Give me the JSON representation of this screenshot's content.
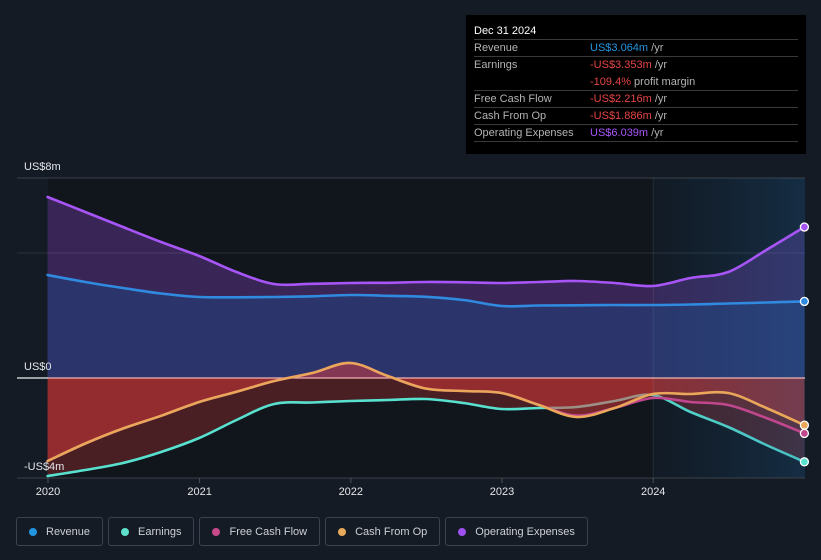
{
  "tooltip": {
    "date": "Dec 31 2024",
    "rows": [
      {
        "label": "Revenue",
        "value": "US$3.064m",
        "unit": "/yr",
        "color": "#2394df"
      },
      {
        "label": "Earnings",
        "value": "-US$3.353m",
        "unit": "/yr",
        "color": "#e64545"
      },
      {
        "label": "",
        "value": "-109.4%",
        "unit": "profit margin",
        "color": "#e64545"
      },
      {
        "label": "Free Cash Flow",
        "value": "-US$2.216m",
        "unit": "/yr",
        "color": "#e64545"
      },
      {
        "label": "Cash From Op",
        "value": "-US$1.886m",
        "unit": "/yr",
        "color": "#e64545"
      },
      {
        "label": "Operating Expenses",
        "value": "US$6.039m",
        "unit": "/yr",
        "color": "#a855f7"
      }
    ]
  },
  "legend": {
    "items": [
      {
        "label": "Revenue",
        "color": "#2394df"
      },
      {
        "label": "Earnings",
        "color": "#5ee0cc"
      },
      {
        "label": "Free Cash Flow",
        "color": "#c84a8a"
      },
      {
        "label": "Cash From Op",
        "color": "#e8a95a"
      },
      {
        "label": "Operating Expenses",
        "color": "#a050f0"
      }
    ]
  },
  "chart_data": {
    "type": "area",
    "title": "",
    "xlabel": "",
    "ylabel": "",
    "unit": "US$ millions",
    "ylim": [
      -4,
      8
    ],
    "y_ticks": [
      {
        "value": 8,
        "label": "US$8m"
      },
      {
        "value": 0,
        "label": "US$0"
      },
      {
        "value": -4,
        "label": "-US$4m"
      }
    ],
    "y_gridlines": [
      8,
      5
    ],
    "x_ticks": [
      {
        "date": "2020-01-01",
        "label": "2020"
      },
      {
        "date": "2021-01-01",
        "label": "2021"
      },
      {
        "date": "2022-01-01",
        "label": "2022"
      },
      {
        "date": "2023-01-01",
        "label": "2023"
      },
      {
        "date": "2024-01-01",
        "label": "2024"
      }
    ],
    "highlight_range": [
      "2024-01-01",
      "2024-12-31"
    ],
    "grid": true,
    "legend_position": "bottom-left",
    "x": [
      "2019-12-31",
      "2020-03-31",
      "2020-06-30",
      "2020-09-30",
      "2020-12-31",
      "2021-03-31",
      "2021-06-30",
      "2021-09-30",
      "2021-12-31",
      "2022-03-31",
      "2022-06-30",
      "2022-09-30",
      "2022-12-31",
      "2023-03-31",
      "2023-06-30",
      "2023-09-30",
      "2023-12-31",
      "2024-03-31",
      "2024-06-30",
      "2024-09-30",
      "2024-12-31"
    ],
    "series": [
      {
        "key": "opex",
        "name": "Operating Expenses",
        "color": "#a855f7",
        "values": [
          7.24,
          6.64,
          6.04,
          5.44,
          4.88,
          4.24,
          3.76,
          3.77,
          3.8,
          3.81,
          3.84,
          3.83,
          3.8,
          3.84,
          3.88,
          3.8,
          3.68,
          4.0,
          4.24,
          5.12,
          6.039
        ]
      },
      {
        "key": "revenue",
        "name": "Revenue",
        "color": "#2f8ae0",
        "values": [
          4.12,
          3.84,
          3.6,
          3.38,
          3.24,
          3.23,
          3.24,
          3.27,
          3.32,
          3.29,
          3.25,
          3.12,
          2.88,
          2.9,
          2.91,
          2.92,
          2.92,
          2.94,
          2.98,
          3.02,
          3.064
        ]
      },
      {
        "key": "earnings",
        "name": "Earnings",
        "color": "#58e1cf",
        "values": [
          -3.92,
          -3.68,
          -3.4,
          -2.96,
          -2.4,
          -1.68,
          -1.04,
          -0.98,
          -0.92,
          -0.88,
          -0.84,
          -1.0,
          -1.24,
          -1.2,
          -1.16,
          -0.92,
          -0.68,
          -1.36,
          -1.96,
          -2.68,
          -3.353
        ]
      },
      {
        "key": "fcf",
        "name": "Free Cash Flow",
        "color": "#c0468e",
        "values": [
          -3.32,
          -2.62,
          -2.02,
          -1.51,
          -0.96,
          -0.55,
          -0.12,
          0.2,
          0.6,
          0.08,
          -0.42,
          -0.52,
          -0.6,
          -1.08,
          -1.5,
          -1.2,
          -0.8,
          -0.96,
          -1.08,
          -1.6,
          -2.216
        ]
      },
      {
        "key": "cfo",
        "name": "Cash From Op",
        "color": "#eaa75a",
        "values": [
          -3.32,
          -2.62,
          -2.02,
          -1.51,
          -0.96,
          -0.55,
          -0.12,
          0.2,
          0.6,
          0.08,
          -0.42,
          -0.52,
          -0.6,
          -1.08,
          -1.56,
          -1.2,
          -0.64,
          -0.64,
          -0.6,
          -1.2,
          -1.886
        ]
      }
    ]
  }
}
